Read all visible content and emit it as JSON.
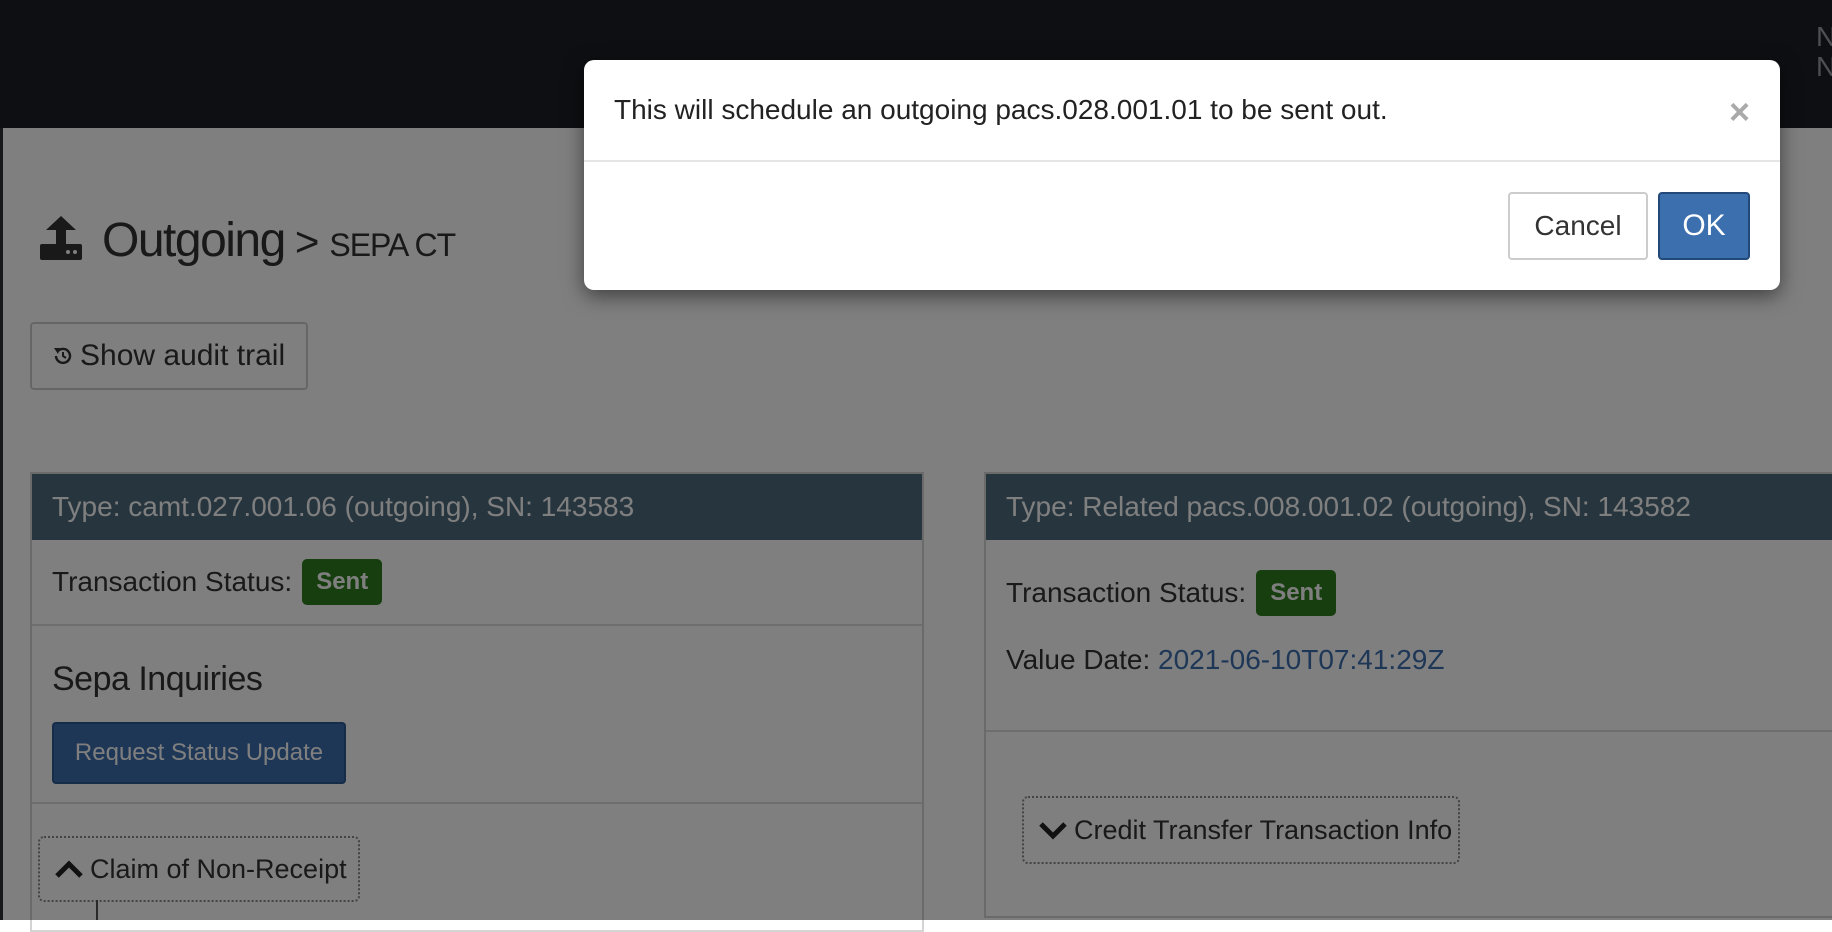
{
  "page": {
    "title": "Outgoing",
    "separator": ">",
    "subtitle": "SEPA CT",
    "audit_button_label": "Show audit trail",
    "topbar_edge_text": "N N"
  },
  "left_panel": {
    "header": "Type: camt.027.001.06 (outgoing), SN: 143583",
    "status_label": "Transaction Status:",
    "status_badge": "Sent",
    "inquiries_title": "Sepa Inquiries",
    "request_button_label": "Request Status Update",
    "toggle_label": "Claim of Non-Receipt"
  },
  "right_panel": {
    "header": "Type: Related pacs.008.001.02 (outgoing), SN: 143582",
    "status_label": "Transaction Status:",
    "status_badge": "Sent",
    "value_date_label": "Value Date:",
    "value_date": "2021-06-10T07:41:29Z",
    "toggle_label": "Credit Transfer Transaction Info"
  },
  "modal": {
    "message": "This will schedule an outgoing pacs.028.001.01 to be sent out.",
    "close_symbol": "×",
    "cancel_label": "Cancel",
    "ok_label": "OK"
  },
  "icons": {
    "title_icon": "upload-icon",
    "audit_icon": "history-icon",
    "left_toggle_icon": "chevron-up-icon",
    "right_toggle_icon": "chevron-down-icon"
  },
  "colors": {
    "topbar": "#1b1f25",
    "panel_header": "#4e6b7c",
    "badge_sent": "#2f7d1d",
    "primary": "#3c6fae"
  }
}
